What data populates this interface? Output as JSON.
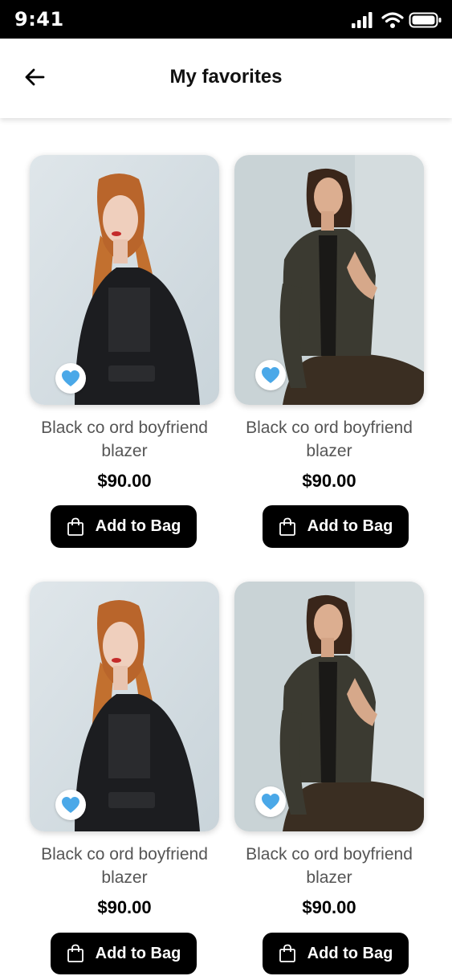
{
  "status": {
    "time": "9:41"
  },
  "header": {
    "title": "My favorites"
  },
  "products": [
    {
      "name": "Black co ord boyfriend blazer",
      "price": "$90.00",
      "button_label": "Add to Bag",
      "favorite": true
    },
    {
      "name": "Black co ord boyfriend blazer",
      "price": "$90.00",
      "button_label": "Add to Bag",
      "favorite": true
    },
    {
      "name": "Black co ord boyfriend blazer",
      "price": "$90.00",
      "button_label": "Add to Bag",
      "favorite": true
    },
    {
      "name": "Black co ord boyfriend blazer",
      "price": "$90.00",
      "button_label": "Add to Bag",
      "favorite": true
    }
  ],
  "colors": {
    "heart": "#4aa8e8",
    "button": "#000000",
    "status_bar": "#000000"
  },
  "icons": {
    "back": "arrow-left-icon",
    "favorite": "heart-icon",
    "bag": "shopping-bag-icon"
  }
}
